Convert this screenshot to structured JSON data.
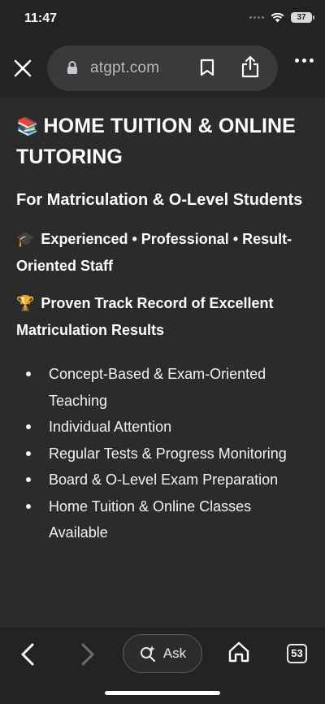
{
  "status": {
    "time": "11:47",
    "battery": "37"
  },
  "browser": {
    "url": "atgpt.com",
    "icons": [
      "close-icon",
      "lock-icon",
      "bookmark-icon",
      "share-icon",
      "more-icon"
    ]
  },
  "page": {
    "heading_emoji": "📚",
    "heading": "HOME TUITION & ONLINE TUTORING",
    "subtitle": "For Matriculation & O-Level Students",
    "line1_emoji": "🎓",
    "line1": "Experienced • Professional • Result-Oriented Staff",
    "line2_emoji": "🏆",
    "line2": "Proven Track Record of Excellent Matriculation Results",
    "bullets": [
      "Concept-Based & Exam-Oriented Teaching",
      "Individual Attention",
      "Regular Tests & Progress Monitoring",
      "Board & O-Level Exam Preparation",
      "Home Tuition & Online Classes Available"
    ]
  },
  "toolbar": {
    "ask_label": "Ask",
    "tab_count": "53",
    "icons": [
      "back-icon",
      "forward-icon",
      "sparkle-search-icon",
      "home-icon",
      "tabs-icon"
    ]
  },
  "colors": {
    "background": "#2b2b2b",
    "chrome": "#232323",
    "url_pill": "#3a3a3c",
    "text": "#f2f2f2"
  }
}
